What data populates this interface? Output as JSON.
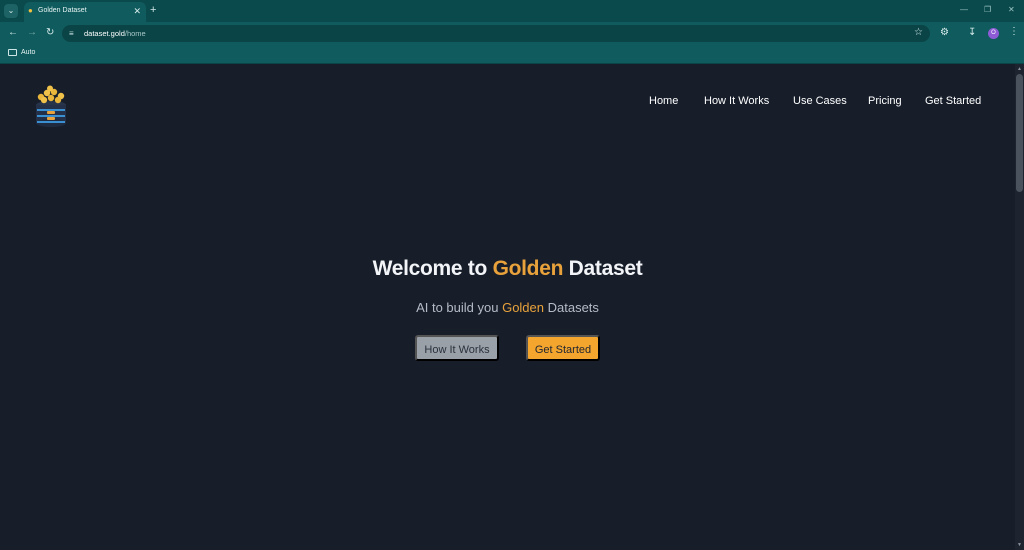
{
  "browser": {
    "tab": {
      "title": "Golden Dataset"
    },
    "address": {
      "domain": "dataset.gold",
      "path": "/home"
    },
    "bookmarks": [
      {
        "label": "Auto"
      }
    ],
    "profile_initial": "O"
  },
  "nav": {
    "items": [
      {
        "label": "Home"
      },
      {
        "label": "How It Works"
      },
      {
        "label": "Use Cases"
      },
      {
        "label": "Pricing"
      },
      {
        "label": "Get Started"
      }
    ]
  },
  "hero": {
    "title_prefix": "Welcome to ",
    "title_highlight": "Golden",
    "title_suffix": " Dataset",
    "subtitle_prefix": "AI to build you ",
    "subtitle_highlight": "Golden",
    "subtitle_suffix": " Datasets",
    "buttons": {
      "secondary": "How It Works",
      "primary": "Get Started"
    }
  },
  "colors": {
    "accent_gold": "#e9a23b",
    "button_primary": "#f4a52e",
    "button_secondary": "#9aa0a8",
    "page_background": "#171e2a",
    "chrome_teal": "#0f5b5d"
  },
  "icons": [
    "tab-list-icon",
    "favicon-icon",
    "close-icon",
    "plus-icon",
    "back-arrow-icon",
    "forward-arrow-icon",
    "reload-icon",
    "site-info-icon",
    "star-icon",
    "extensions-icon",
    "download-icon",
    "kebab-menu-icon",
    "folder-icon",
    "logo-icon"
  ]
}
